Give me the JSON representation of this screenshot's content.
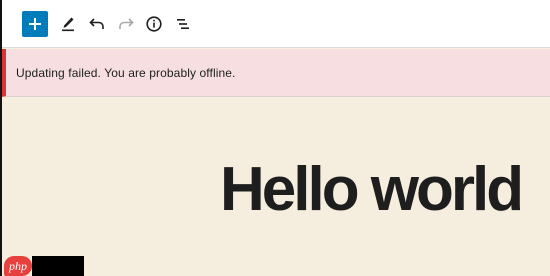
{
  "toolbar": {
    "buttons": [
      {
        "name": "add-block-button",
        "icon": "plus-icon",
        "enabled": true
      },
      {
        "name": "tools-button",
        "icon": "pencil-icon",
        "enabled": true
      },
      {
        "name": "undo-button",
        "icon": "undo-icon",
        "enabled": true
      },
      {
        "name": "redo-button",
        "icon": "redo-icon",
        "enabled": false
      },
      {
        "name": "details-button",
        "icon": "info-icon",
        "enabled": true
      },
      {
        "name": "list-view-button",
        "icon": "list-view-icon",
        "enabled": true
      }
    ]
  },
  "notice": {
    "message": "Updating failed. You are probably offline.",
    "type": "error"
  },
  "editor": {
    "heading": "Hello world"
  },
  "watermark": {
    "text": "php"
  },
  "colors": {
    "accent": "#007cba",
    "error_bar": "#d63638",
    "error_bg": "#f7dfe1",
    "canvas_bg": "#f5eedf",
    "text": "#1e1e1e",
    "disabled": "#a7aaad"
  }
}
